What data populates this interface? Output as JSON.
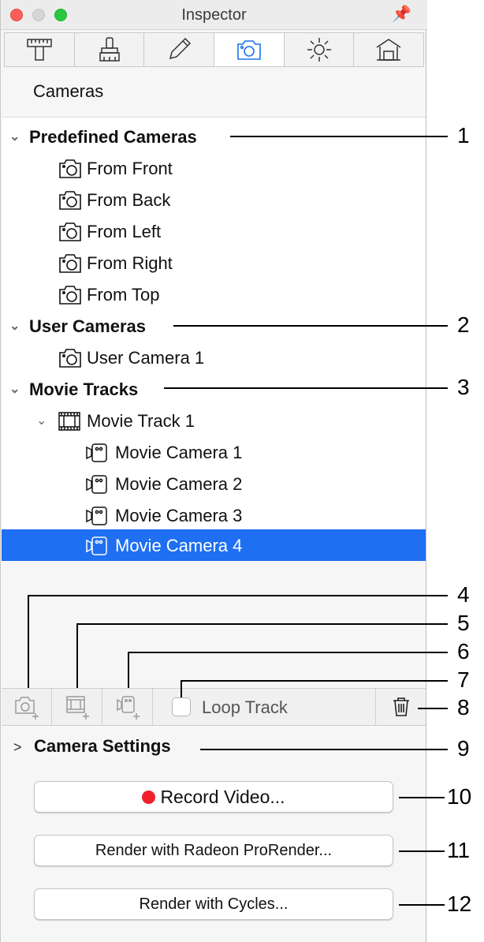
{
  "window": {
    "title": "Inspector"
  },
  "tabs": [
    {
      "icon": "ruler-icon"
    },
    {
      "icon": "brush-icon"
    },
    {
      "icon": "pencil-icon"
    },
    {
      "icon": "camera-icon",
      "active": true
    },
    {
      "icon": "sun-icon"
    },
    {
      "icon": "house-icon"
    }
  ],
  "section": {
    "title": "Cameras"
  },
  "tree": {
    "predefined": {
      "label": "Predefined Cameras",
      "items": [
        "From Front",
        "From Back",
        "From Left",
        "From Right",
        "From Top"
      ]
    },
    "user": {
      "label": "User Cameras",
      "items": [
        "User Camera 1"
      ]
    },
    "movie": {
      "label": "Movie Tracks",
      "track": "Movie Track 1",
      "cameras": [
        "Movie Camera 1",
        "Movie Camera 2",
        "Movie Camera 3",
        "Movie Camera 4"
      ],
      "selected": "Movie Camera 4"
    }
  },
  "toolbar": {
    "loop_label": "Loop Track"
  },
  "settings": {
    "label": "Camera Settings"
  },
  "buttons": {
    "record": "Record Video...",
    "radeon": "Render with Radeon ProRender...",
    "cycles": "Render with Cycles..."
  },
  "callouts": [
    "1",
    "2",
    "3",
    "4",
    "5",
    "6",
    "7",
    "8",
    "9",
    "10",
    "11",
    "12"
  ],
  "colors": {
    "selection": "#1e6ff2",
    "record_dot": "#f0202a",
    "accent": "#1a74e8"
  }
}
